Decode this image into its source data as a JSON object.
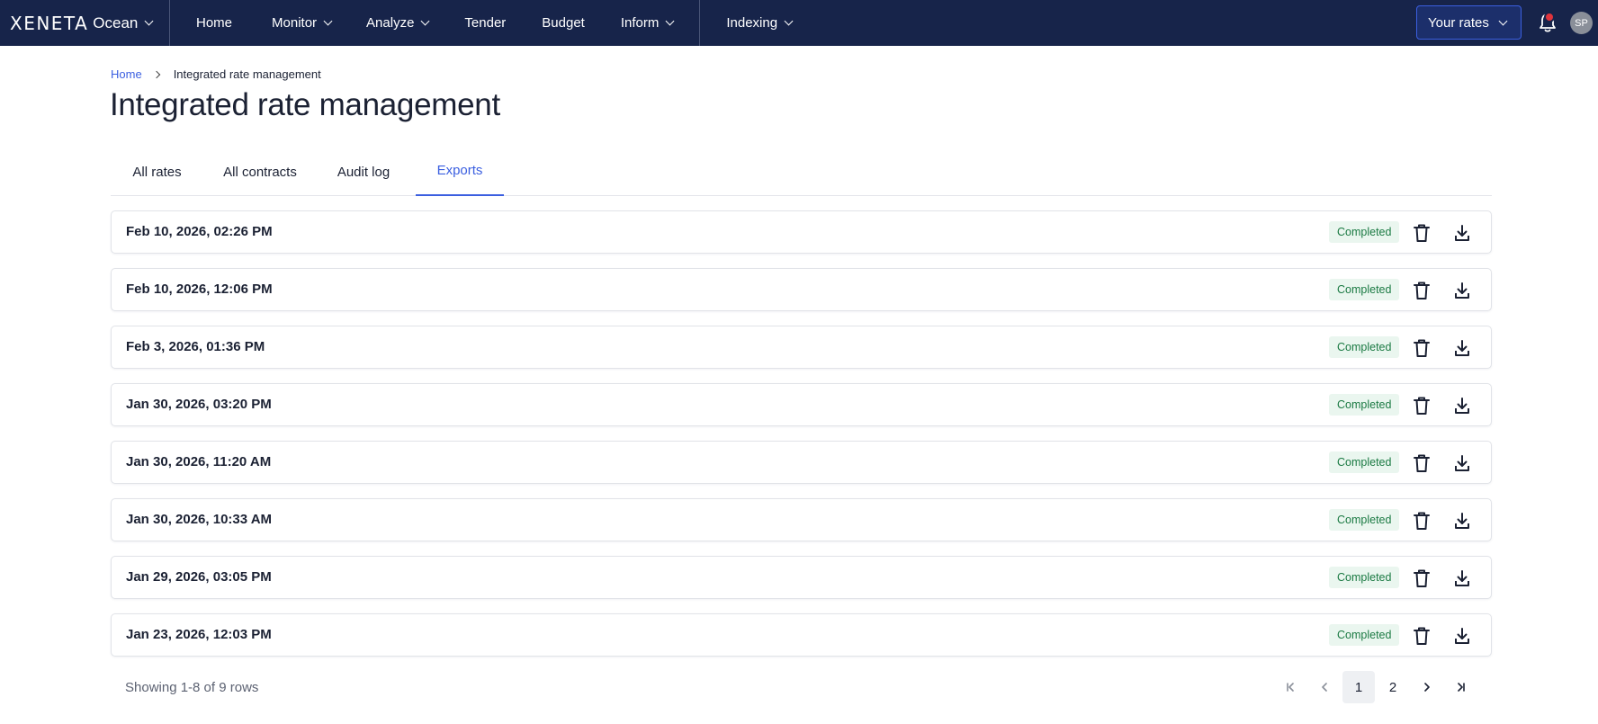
{
  "nav": {
    "logo": "XENETA",
    "product": "Ocean",
    "items": [
      {
        "label": "Home"
      },
      {
        "label": "Monitor"
      },
      {
        "label": "Analyze"
      },
      {
        "label": "Tender"
      },
      {
        "label": "Budget"
      },
      {
        "label": "Inform"
      },
      {
        "label": "Indexing"
      }
    ],
    "your_rates_label": "Your rates",
    "avatar_initials": "SP",
    "notification_color": "#e0343c",
    "bg_color": "#17244a"
  },
  "breadcrumb": {
    "home": "Home",
    "current": "Integrated rate management"
  },
  "page_title": "Integrated rate management",
  "tabs": [
    {
      "label": "All rates",
      "active": false
    },
    {
      "label": "All contracts",
      "active": false
    },
    {
      "label": "Audit log",
      "active": false
    },
    {
      "label": "Exports",
      "active": true
    }
  ],
  "exports": [
    {
      "date": "Feb 10, 2026, 02:26 PM",
      "status": "Completed"
    },
    {
      "date": "Feb 10, 2026, 12:06 PM",
      "status": "Completed"
    },
    {
      "date": "Feb 3, 2026, 01:36 PM",
      "status": "Completed"
    },
    {
      "date": "Jan 30, 2026, 03:20 PM",
      "status": "Completed"
    },
    {
      "date": "Jan 30, 2026, 11:20 AM",
      "status": "Completed"
    },
    {
      "date": "Jan 30, 2026, 10:33 AM",
      "status": "Completed"
    },
    {
      "date": "Jan 29, 2026, 03:05 PM",
      "status": "Completed"
    },
    {
      "date": "Jan 23, 2026, 12:03 PM",
      "status": "Completed"
    }
  ],
  "row_icons": {
    "delete": "trash-icon",
    "download": "download-icon"
  },
  "footer": {
    "showing": "Showing 1-8 of 9 rows",
    "pages": [
      "1",
      "2"
    ],
    "current_page": "1"
  },
  "colors": {
    "accent": "#3b5fe0",
    "status_completed_bg": "#eaf6ef",
    "status_completed_text": "#1b7a43"
  }
}
